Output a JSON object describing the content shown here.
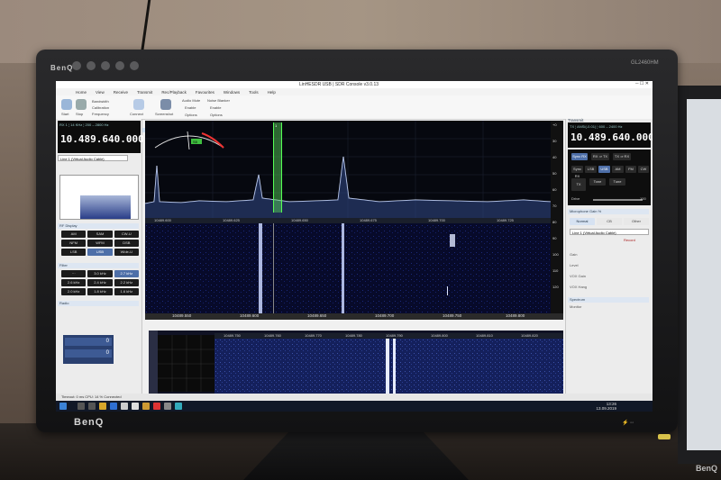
{
  "window": {
    "title": "LinHESDR USB | SDR Console v3.0.13"
  },
  "ribbon": {
    "tabs": [
      "Home",
      "View",
      "Receive",
      "Transmit",
      "Rec/Playback",
      "Favourites",
      "Windows",
      "Tools",
      "Help"
    ],
    "buttons": [
      "Start",
      "Stop",
      "Bandwidth",
      "Calibration",
      "Frequency",
      "Connect",
      "Screenshot"
    ],
    "options": [
      "Audio Mute",
      "Noise Blanker",
      "Enable",
      "Enable",
      "Options",
      "Options"
    ]
  },
  "left_panel": {
    "freq_header": "RX 1  ¦  14 KHz ¦  200 – 2800 Hz",
    "frequency": "10.489.640.000",
    "audio_device": "Line 1 (Virtual Audio Cable)",
    "sections": {
      "display": "RF Display",
      "filter": "Filter",
      "radio": "Radio"
    },
    "mode_buttons": [
      "AM",
      "SAM",
      "CW-U",
      "NFM",
      "WFM",
      "DSB",
      "LSB",
      "USB",
      "Wide-U"
    ],
    "filter_buttons": [
      "···",
      "3.0 kHz",
      "2.7 kHz",
      "2.6 kHz",
      "2.4 kHz",
      "2.2 kHz",
      "2.0 kHz",
      "1.8 kHz",
      "1.6 kHz"
    ],
    "rit_values": [
      "0",
      "0"
    ]
  },
  "spectrum": {
    "freq_labels": [
      "10489.600",
      "10489.625",
      "10489.650",
      "10489.675",
      "10489.700",
      "10489.725"
    ],
    "waterfall_labels": [
      "10489.550",
      "10489.600",
      "10489.650",
      "10489.700",
      "10489.750",
      "10489.800"
    ],
    "db_scale": [
      "+0",
      "30",
      "40",
      "50",
      "60",
      "70",
      "80",
      "90",
      "100",
      "110",
      "120"
    ],
    "vfo_marker": "1",
    "smeter_value": "S5"
  },
  "lower_pane": {
    "freq_labels": [
      "10489.750",
      "10489.760",
      "10489.770",
      "10489.780",
      "10489.790",
      "10489.800",
      "10489.810",
      "10489.820"
    ]
  },
  "right_panel": {
    "header": "Transmit",
    "freq_header": "TX  ¦  ANSI(-0.01)  ¦  600 – 2400 Hz",
    "frequency": "10.489.640.000",
    "buttons": {
      "sync_rx": "Sync RX",
      "rx_tx": "RX ⇒ TX",
      "tx_rx": "TX ⇒ RX",
      "modes": [
        "Sync RX",
        "LSB",
        "USB",
        "AM",
        "FM",
        "CW"
      ],
      "tx": "TX",
      "tone": "Tone",
      "tune": "Tune"
    },
    "drive_label": "Drive",
    "drive_value": "100",
    "mic_header": "Microphone Gain %",
    "mic_sources": [
      "Normal",
      "CB",
      "Other"
    ],
    "mic_device": "Line 1 (Virtual Audio Cable)",
    "record_label": "Record",
    "rows": [
      "Gain",
      "Level",
      "VOX Gain",
      "VOX Hang"
    ],
    "spectrum_label": "Spectrum",
    "monitor_label": "Monitor"
  },
  "statusbar": {
    "text": "Timeout: 0 ms  CPU: 14 %  Connected"
  },
  "taskbar": {
    "time": "13:26",
    "date": "13.09.2019"
  },
  "monitor": {
    "brand": "BenQ",
    "model": "GL2460HM"
  },
  "monitor2": {
    "brand": "BenQ"
  }
}
